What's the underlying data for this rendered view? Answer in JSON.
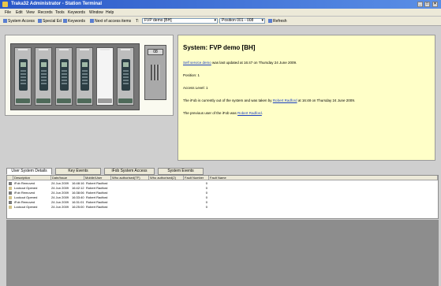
{
  "window": {
    "title": "Traka32 Administrator - Station Terminal",
    "controls": [
      "_",
      "□",
      "×"
    ]
  },
  "menu": [
    "File",
    "Edit",
    "View",
    "Records",
    "Tools",
    "Keywords",
    "Window",
    "Help"
  ],
  "toolbar": {
    "user_access": "System Access",
    "special": "Special Ed",
    "keywords": "Keywords",
    "next": "Next of access items",
    "combo_label": "T:",
    "system_combo": "FVP demo [BH]",
    "position_combo": "Position 001 - 008",
    "refresh": "Refresh"
  },
  "cabinet": {
    "slots": 6,
    "empty_slot_index": 4,
    "keypad_display": "08"
  },
  "info": {
    "title": "System: FVP demo [BH]",
    "line1_link": "Self service demo",
    "line1_rest": " was last updated at 16:47 on Thursday 24 June 2009.",
    "line2": "Position: 1",
    "line3": "Access Level: 1",
    "line4_pre": "The iFob is currently out of the system and was taken by ",
    "line4_link": "Robert Radford",
    "line4_post": " at 16:48 on Thursday 24 June 2009.",
    "line5_pre": "The previous user of the iFob was ",
    "line5_link": "Robert Radford",
    "line5_post": "."
  },
  "tabs": [
    "User System Details",
    "Key Events",
    "iFob System Access",
    "System Events"
  ],
  "table": {
    "headers": [
      "Description",
      "Date/Issue",
      "Mobile/User",
      "Who authorised(TF)",
      "Who authorised(2)",
      "Fault Number",
      "Fault Name"
    ],
    "rows": [
      [
        "iFob Removed",
        "24 Jun 2009",
        "16:48:16",
        "Robert Radford",
        "",
        "",
        "0",
        ""
      ],
      [
        "Lockout Opened",
        "24 Jun 2009",
        "16:42:12",
        "Robert Radford",
        "",
        "",
        "0",
        ""
      ],
      [
        "iFob Removed",
        "24 Jun 2009",
        "16:38:06",
        "Robert Radford",
        "",
        "",
        "0",
        ""
      ],
      [
        "Lockout Opened",
        "24 Jun 2009",
        "16:33:40",
        "Robert Radford",
        "",
        "",
        "0",
        ""
      ],
      [
        "iFob Removed",
        "24 Jun 2009",
        "16:31:01",
        "Robert Radford",
        "",
        "",
        "0",
        ""
      ],
      [
        "Lockout Opened",
        "24 Jun 2009",
        "16:25:00",
        "Robert Radford",
        "",
        "",
        "0",
        ""
      ]
    ]
  },
  "colors": {
    "title_bar": "#2a58c8",
    "info_bg": "#ffffc8",
    "link": "#1a3fc0",
    "cabinet": "#767676"
  }
}
